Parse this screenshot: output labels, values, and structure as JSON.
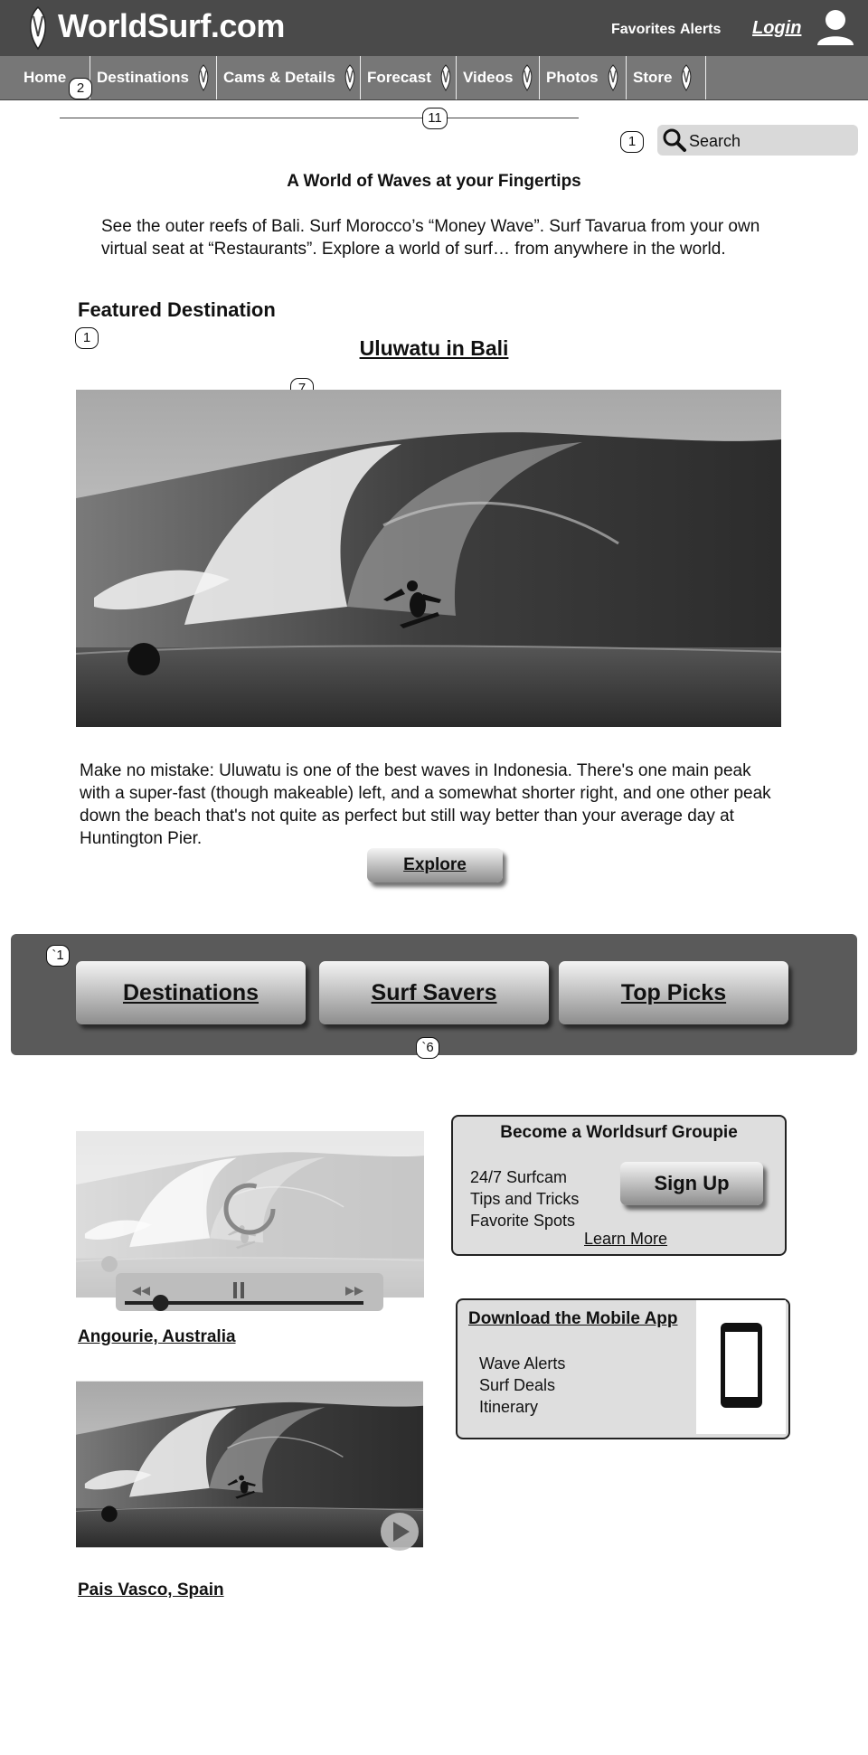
{
  "header": {
    "site_title": "WorldSurf.com",
    "links": {
      "favorites": "Favorites",
      "alerts": "Alerts",
      "login": "Login"
    },
    "logo_icon": "surfboard-icon",
    "user_icon": "user-icon"
  },
  "nav": {
    "items": [
      {
        "label": "Home",
        "icon": ""
      },
      {
        "label": "Destinations",
        "icon": "surfboard-icon"
      },
      {
        "label": "Cams & Details",
        "icon": "surfboard-icon"
      },
      {
        "label": "Forecast",
        "icon": "surfboard-icon"
      },
      {
        "label": "Videos",
        "icon": "surfboard-icon"
      },
      {
        "label": "Photos",
        "icon": "surfboard-icon"
      },
      {
        "label": "Store",
        "icon": "surfboard-icon"
      }
    ]
  },
  "annotations": {
    "home": "2",
    "divider": "11",
    "search": "1",
    "featured": "1",
    "hero": "7",
    "categories": "`1",
    "categories_bottom": "`6"
  },
  "search": {
    "label": "Search"
  },
  "main": {
    "tagline": "A World of Waves at your Fingertips",
    "intro": "See the outer reefs of Bali. Surf Morocco’s “Money Wave”. Surf Tavarua from your own virtual seat at “Restaurants”. Explore a world of surf… from anywhere in the world.",
    "featured_heading": "Featured Destination",
    "featured_title": "Uluwatu in Bali",
    "description": "Make no mistake: Uluwatu is one of the best waves in Indonesia. There's one main peak with a super-fast (though makeable) left, and a somewhat shorter right, and one other peak down the beach that's not quite as perfect but still way better than your average day at Huntington Pier.",
    "explore_label": "Explore"
  },
  "categories": {
    "buttons": [
      "Destinations",
      "Surf Savers",
      "Top Picks"
    ]
  },
  "videos": [
    {
      "label": "Angourie, Australia",
      "state": "loading",
      "progress": 0.15
    },
    {
      "label": "Pais Vasco, Spain",
      "state": "paused"
    }
  ],
  "groupie": {
    "title": "Become a Worldsurf Groupie",
    "features": [
      "24/7 Surfcam",
      "Tips and Tricks",
      "Favorite Spots"
    ],
    "signup_label": "Sign Up",
    "learn_more": "Learn More"
  },
  "app": {
    "title": "Download the Mobile App",
    "features": [
      "Wave Alerts",
      "Surf Deals",
      "Itinerary"
    ],
    "icon": "smartphone-icon"
  },
  "colors": {
    "header_bg": "#4a4a4a",
    "nav_bg": "#777777",
    "panel_bg": "#5a5a5a",
    "box_bg": "#dedede"
  }
}
